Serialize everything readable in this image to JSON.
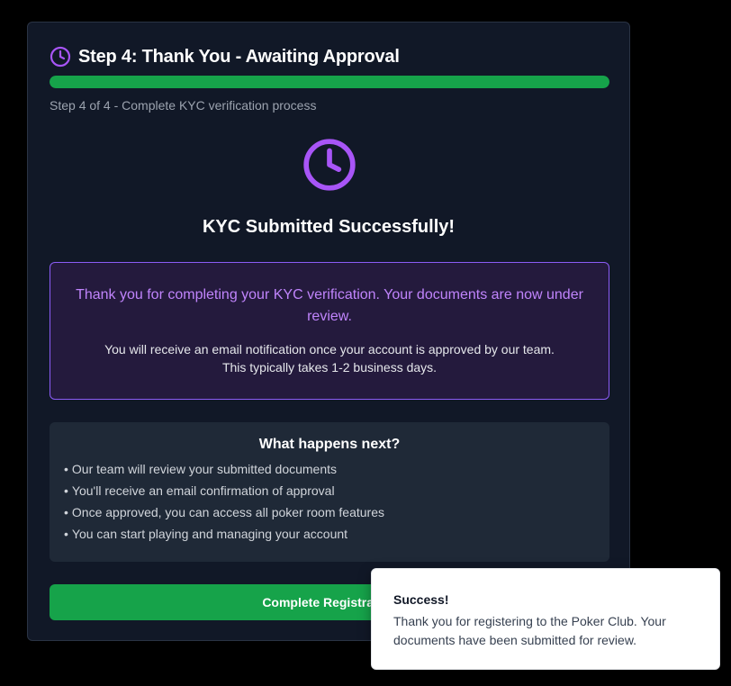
{
  "header": {
    "icon": "clock-icon",
    "title": "Step 4: Thank You - Awaiting Approval"
  },
  "progress": {
    "fraction": 1.0,
    "caption": "Step 4 of 4 - Complete KYC verification process"
  },
  "status": {
    "icon": "clock-icon",
    "title": "KYC Submitted Successfully!"
  },
  "notice": {
    "main": "Thank you for completing your KYC verification. Your documents are now under review.",
    "sub": "You will receive an email notification once your account is approved by our team. This typically takes 1-2 business days."
  },
  "next_steps": {
    "title": "What happens next?",
    "bullet": "•",
    "items": [
      "Our team will review your submitted documents",
      "You'll receive an email confirmation of approval",
      "Once approved, you can access all poker room features",
      "You can start playing and managing your account"
    ]
  },
  "complete_button": {
    "label": "Complete Registration"
  },
  "toast": {
    "title": "Success!",
    "body": "Thank you for registering to the Poker Club. Your documents have been submitted for review."
  },
  "colors": {
    "accent_purple": "#a855f7",
    "success_green": "#16a34a",
    "card_background": "#111827"
  }
}
